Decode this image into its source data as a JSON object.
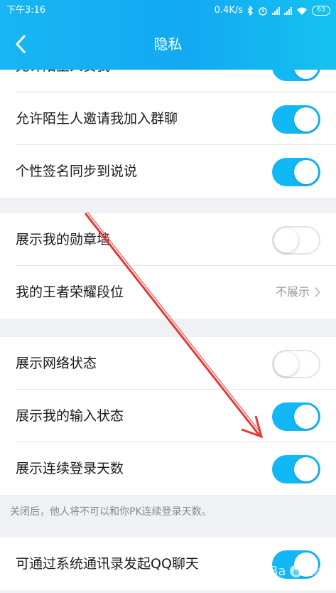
{
  "status": {
    "time": "下午3:16",
    "speed": "0.4K/s",
    "battery": "63"
  },
  "header": {
    "title": "隐私",
    "back_icon": "chevron-left-icon"
  },
  "groups": [
    {
      "rows": [
        {
          "label": "允许陌生人赞我",
          "state": "on"
        },
        {
          "label": "允许陌生人邀请我加入群聊",
          "state": "on"
        },
        {
          "label": "个性签名同步到说说",
          "state": "on"
        }
      ]
    },
    {
      "rows": [
        {
          "label": "展示我的勋章墙",
          "state": "off"
        },
        {
          "label": "我的王者荣耀段位",
          "value": "不展示"
        }
      ]
    },
    {
      "rows": [
        {
          "label": "展示网络状态",
          "state": "off"
        },
        {
          "label": "展示我的输入状态",
          "state": "on"
        },
        {
          "label": "展示连续登录天数",
          "state": "on"
        }
      ]
    },
    {
      "rows": [
        {
          "label": "可通过系统通讯录发起QQ聊天",
          "state": "on"
        }
      ]
    }
  ],
  "notes": {
    "login_days": "关闭后，他人将不可以和你PK连续登录天数。"
  },
  "colors": {
    "accent": "#12b7f5",
    "annotation_arrow": "#e53935"
  }
}
